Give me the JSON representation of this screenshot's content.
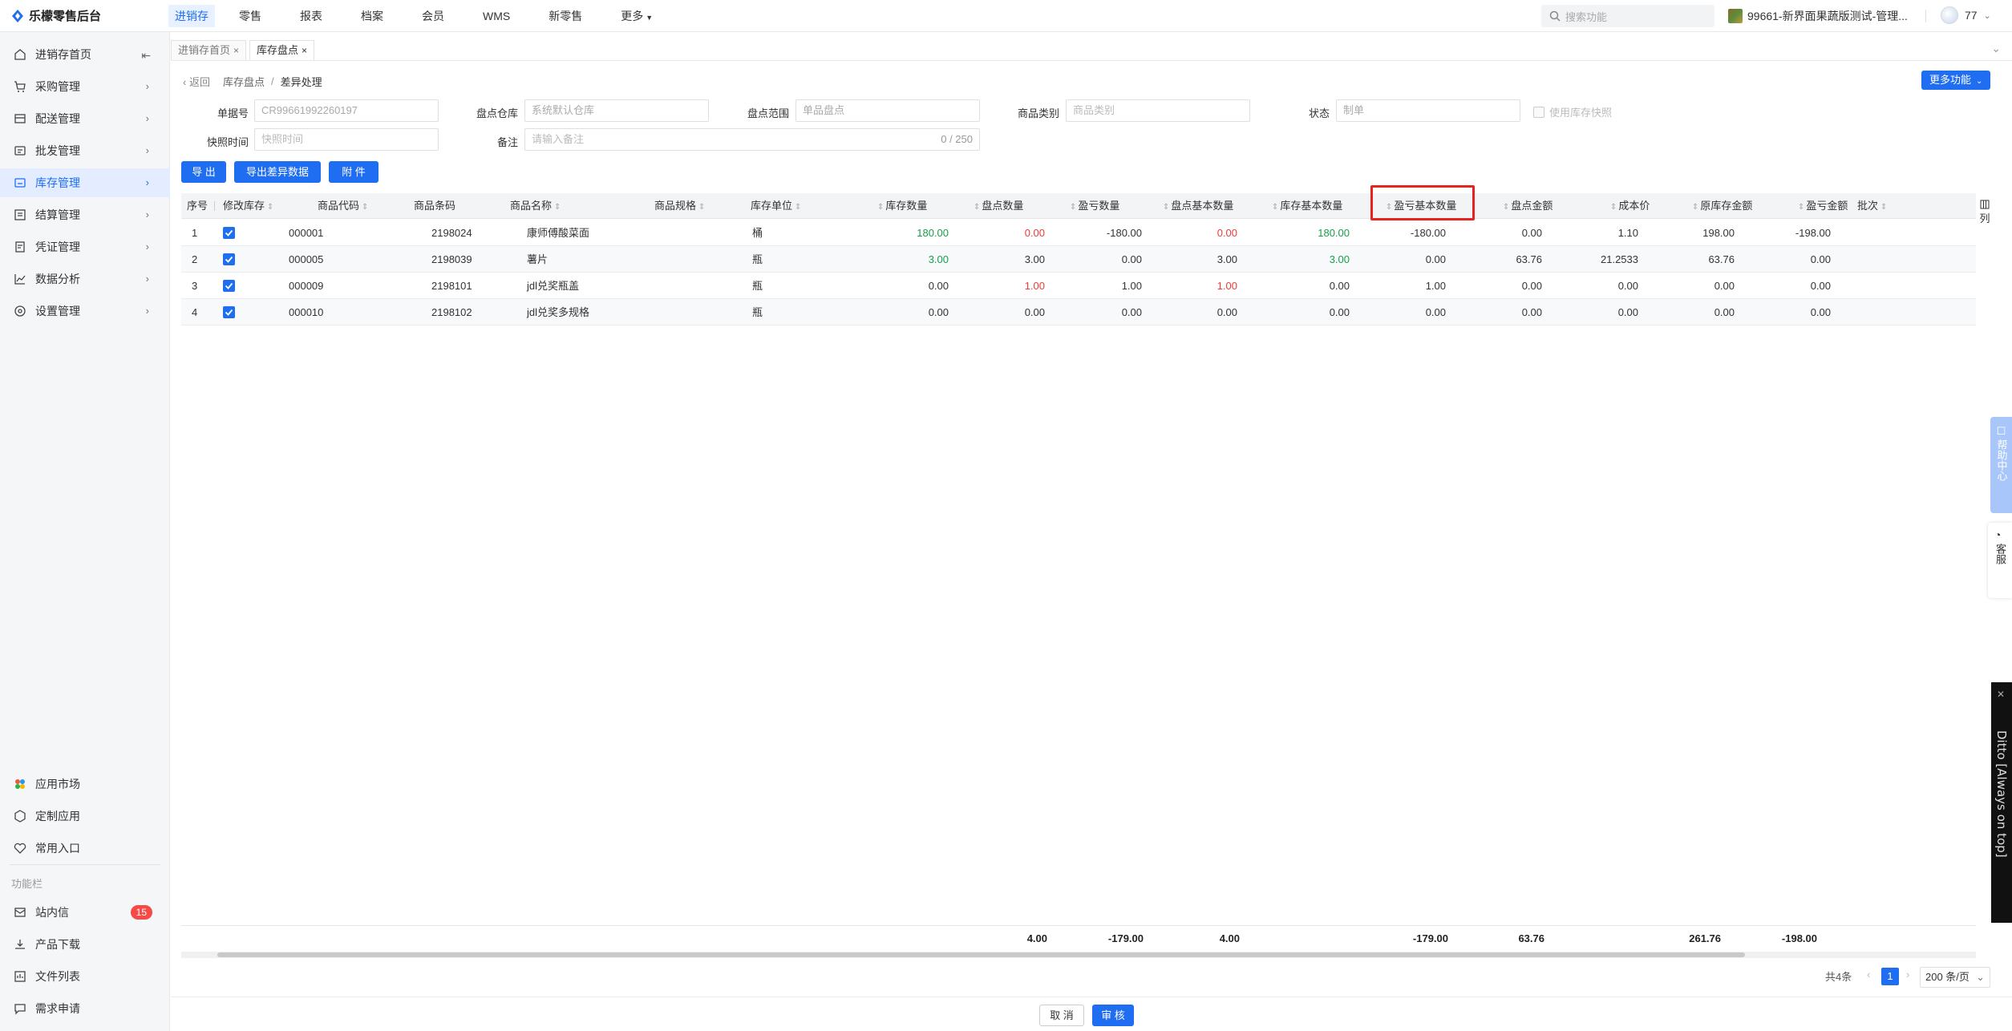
{
  "app": {
    "title": "乐檬零售后台"
  },
  "topnav": {
    "items": [
      "进销存",
      "零售",
      "报表",
      "档案",
      "会员",
      "WMS",
      "新零售",
      "更多"
    ],
    "active_index": 0
  },
  "search": {
    "placeholder": "搜索功能"
  },
  "store": {
    "name": "99661-新界面果蔬版测试-管理..."
  },
  "user": {
    "name": "77"
  },
  "sidebar": {
    "items": [
      {
        "label": "进销存首页",
        "icon": "home-icon"
      },
      {
        "label": "采购管理",
        "icon": "cart-icon"
      },
      {
        "label": "配送管理",
        "icon": "delivery-icon"
      },
      {
        "label": "批发管理",
        "icon": "wholesale-icon"
      },
      {
        "label": "库存管理",
        "icon": "inventory-icon"
      },
      {
        "label": "结算管理",
        "icon": "settlement-icon"
      },
      {
        "label": "凭证管理",
        "icon": "voucher-icon"
      },
      {
        "label": "数据分析",
        "icon": "chart-icon"
      },
      {
        "label": "设置管理",
        "icon": "settings-icon"
      }
    ],
    "active_index": 4,
    "bottom_items": [
      {
        "label": "应用市场",
        "icon": "app-market-icon"
      },
      {
        "label": "定制应用",
        "icon": "custom-app-icon"
      },
      {
        "label": "常用入口",
        "icon": "heart-icon"
      }
    ],
    "group_label": "功能栏",
    "func_items": [
      {
        "label": "站内信",
        "icon": "mail-icon",
        "badge": "15"
      },
      {
        "label": "产品下载",
        "icon": "download-icon"
      },
      {
        "label": "文件列表",
        "icon": "file-list-icon"
      },
      {
        "label": "需求申请",
        "icon": "request-icon"
      }
    ]
  },
  "tabs": [
    {
      "label": "进销存首页"
    },
    {
      "label": "库存盘点"
    }
  ],
  "breadcrumb": {
    "back": "返回",
    "parent": "库存盘点",
    "sep": "/",
    "current": "差异处理"
  },
  "more_button": "更多功能",
  "form": {
    "order_no": {
      "label": "单据号",
      "value": "CR99661992260197"
    },
    "warehouse": {
      "label": "盘点仓库",
      "value": "系统默认仓库"
    },
    "scope": {
      "label": "盘点范围",
      "value": "单品盘点"
    },
    "category": {
      "label": "商品类别",
      "placeholder": "商品类别"
    },
    "status": {
      "label": "状态",
      "value": "制单"
    },
    "use_snapshot": {
      "label": "使用库存快照"
    },
    "snapshot_time": {
      "label": "快照时间",
      "placeholder": "快照时间"
    },
    "remark": {
      "label": "备注",
      "placeholder": "请输入备注",
      "counter": "0 / 250"
    }
  },
  "actions": {
    "export": "导 出",
    "export_diff": "导出差异数据",
    "attachment": "附 件"
  },
  "table": {
    "headers": [
      "序号",
      "修改库存",
      "商品代码",
      "商品条码",
      "商品名称",
      "商品规格",
      "库存单位",
      "库存数量",
      "盘点数量",
      "盈亏数量",
      "盘点基本数量",
      "库存基本数量",
      "盈亏基本数量",
      "盘点金额",
      "成本价",
      "原库存金额",
      "盈亏金额",
      "批次"
    ],
    "rows": [
      {
        "no": "1",
        "code": "000001",
        "barcode": "2198024",
        "name": "康师傅酸菜面",
        "spec": "",
        "unit": "桶",
        "stock_qty": "180.00",
        "count_qty": "0.00",
        "diff_qty": "-180.00",
        "count_base": "0.00",
        "stock_base": "180.00",
        "diff_base": "-180.00",
        "count_amt": "0.00",
        "cost": "1.10",
        "orig_amt": "198.00",
        "diff_amt": "-198.00"
      },
      {
        "no": "2",
        "code": "000005",
        "barcode": "2198039",
        "name": "薯片",
        "spec": "",
        "unit": "瓶",
        "stock_qty": "3.00",
        "count_qty": "3.00",
        "diff_qty": "0.00",
        "count_base": "3.00",
        "stock_base": "3.00",
        "diff_base": "0.00",
        "count_amt": "63.76",
        "cost": "21.2533",
        "orig_amt": "63.76",
        "diff_amt": "0.00"
      },
      {
        "no": "3",
        "code": "000009",
        "barcode": "2198101",
        "name": "jdl兑奖瓶盖",
        "spec": "",
        "unit": "瓶",
        "stock_qty": "0.00",
        "count_qty": "1.00",
        "diff_qty": "1.00",
        "count_base": "1.00",
        "stock_base": "0.00",
        "diff_base": "1.00",
        "count_amt": "0.00",
        "cost": "0.00",
        "orig_amt": "0.00",
        "diff_amt": "0.00"
      },
      {
        "no": "4",
        "code": "000010",
        "barcode": "2198102",
        "name": "jdl兑奖多规格",
        "spec": "",
        "unit": "瓶",
        "stock_qty": "0.00",
        "count_qty": "0.00",
        "diff_qty": "0.00",
        "count_base": "0.00",
        "stock_base": "0.00",
        "diff_base": "0.00",
        "count_amt": "0.00",
        "cost": "0.00",
        "orig_amt": "0.00",
        "diff_amt": "0.00"
      }
    ],
    "totals": {
      "count_qty": "4.00",
      "diff_qty": "-179.00",
      "count_base": "4.00",
      "diff_base": "-179.00",
      "count_amt": "63.76",
      "orig_amt": "261.76",
      "diff_amt": "-198.00"
    },
    "column_settings": "列"
  },
  "pager": {
    "total": "共4条",
    "page": "1",
    "size": "200 条/页"
  },
  "bottom": {
    "cancel": "取 消",
    "approve": "审 核"
  },
  "float": {
    "help": "帮助中心",
    "service": "客服",
    "ditto": "Ditto [Always on top]"
  },
  "colors": {
    "accent": "#1f6df1",
    "positive": "#14a04a",
    "negative": "#f03a3a",
    "highlight_box": "#e8231f"
  }
}
